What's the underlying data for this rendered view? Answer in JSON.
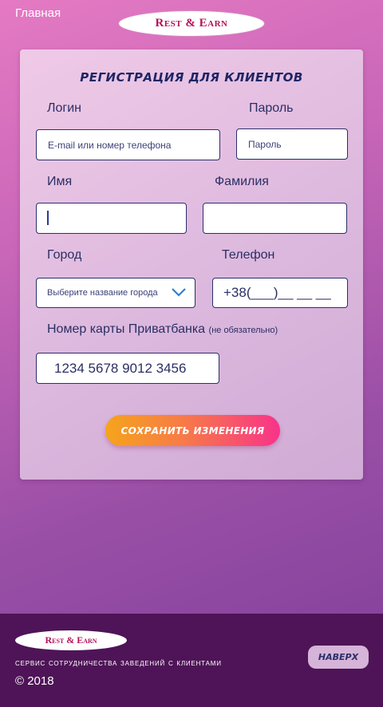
{
  "header": {
    "home_label": "Главная",
    "logo_text": "Rest & Earn"
  },
  "form": {
    "title": "РЕГИСТРАЦИЯ ДЛЯ КЛИЕНТОВ",
    "login": {
      "label": "Логин",
      "placeholder": "E-mail или номер телефона"
    },
    "password": {
      "label": "Пароль",
      "placeholder": "Пароль"
    },
    "first_name": {
      "label": "Имя",
      "value": ""
    },
    "last_name": {
      "label": "Фамилия",
      "value": ""
    },
    "city": {
      "label": "Город",
      "placeholder": "Выберите название города"
    },
    "phone": {
      "label": "Телефон",
      "value": "+38(___)__ __ __"
    },
    "card": {
      "label": "Номер карты Приватбанка",
      "label_note": "(не обязательно)",
      "value": "1234 5678 9012 3456"
    },
    "save_label": "СОХРАНИТЬ ИЗМЕНЕНИЯ"
  },
  "footer": {
    "logo_text": "Rest & Earn",
    "tagline": "СЕРВИС СОТРУДНИЧЕСТВА ЗАВЕДЕНИЙ С КЛИЕНТАМИ",
    "copyright": "© 2018",
    "top_button_label": "НАВЕРХ"
  },
  "colors": {
    "accent_text": "#1d2565",
    "button_gradient_start": "#f6a41c",
    "button_gradient_end": "#f8338a",
    "footer_bg": "#4e1457",
    "logo_text": "#b3125a"
  },
  "icons": {
    "city_dropdown": "chevron-down-icon"
  }
}
